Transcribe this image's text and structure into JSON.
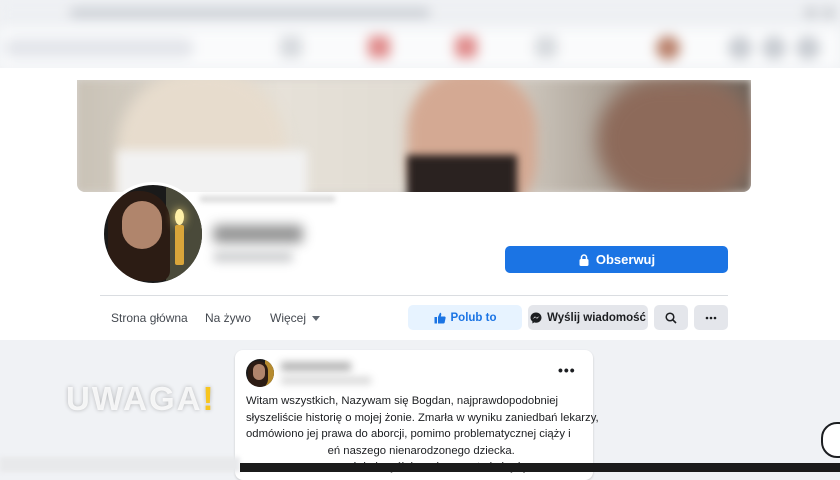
{
  "profile": {
    "follow_label": "Obserwuj"
  },
  "tabs": [
    {
      "label": "Strona główna"
    },
    {
      "label": "Na żywo"
    },
    {
      "label": "Więcej"
    }
  ],
  "actions": {
    "like_label": "Polub to",
    "message_label": "Wyślij wiadomość"
  },
  "post": {
    "menu_label": "•••",
    "text_lines": [
      "Witam wszystkich, Nazywam się Bogdan, najprawdopodobniej",
      "słyszeliście historię o mojej żonie. Zmarła w wyniku zaniedbań lekarzy,",
      "odmówiono jej prawa do aborcji, pomimo problematycznej ciąży i",
      "                          eń naszego nienarodzonego dziecka.",
      "                          wrześniu i myślałem, że nawet nie będę"
    ]
  },
  "watermark": {
    "text": "UWAGA",
    "mark": "!"
  },
  "colors": {
    "accent": "#1b74e4",
    "like_bg": "#e7f3ff",
    "button_bg": "#e4e6eb",
    "page_bg": "#f0f2f5",
    "watermark_accent": "#f7c51e"
  },
  "icons": [
    "lock-icon",
    "thumbs-up-icon",
    "messenger-icon",
    "search-icon",
    "more-dots-icon",
    "caret-down-icon"
  ]
}
